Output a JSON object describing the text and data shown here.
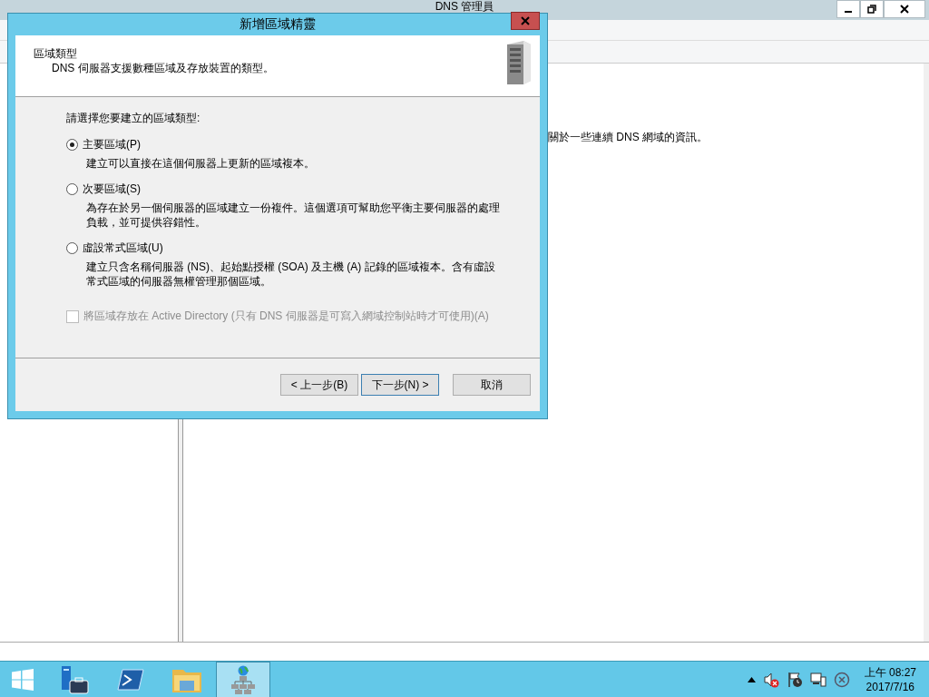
{
  "main_window": {
    "title": "DNS 管理員",
    "body_text": "關於一些連續 DNS 網域的資訊。"
  },
  "dialog": {
    "title": "新增區域精靈",
    "heading": "區域類型",
    "subheading": "DNS 伺服器支援數種區域及存放裝置的類型。",
    "prompt": "請選擇您要建立的區域類型:",
    "options": [
      {
        "label": "主要區域(P)",
        "description": "建立可以直接在這個伺服器上更新的區域複本。",
        "selected": true
      },
      {
        "label": "次要區域(S)",
        "description": "為存在於另一個伺服器的區域建立一份複件。這個選項可幫助您平衡主要伺服器的處理負載，並可提供容錯性。",
        "selected": false
      },
      {
        "label": "虛設常式區域(U)",
        "description": "建立只含名稱伺服器 (NS)、起始點授權 (SOA) 及主機 (A) 記錄的區域複本。含有虛設常式區域的伺服器無權管理那個區域。",
        "selected": false
      }
    ],
    "ad_checkbox": {
      "label": "將區域存放在 Active Directory (只有 DNS 伺服器是可寫入網域控制站時才可使用)(A)",
      "checked": false,
      "disabled": true
    },
    "buttons": [
      {
        "label": "< 上一步(B)",
        "default": false
      },
      {
        "label": "下一步(N) >",
        "default": true
      },
      {
        "label": "取消",
        "default": false
      }
    ]
  },
  "taskbar": {
    "apps": [
      {
        "kind": "server-manager",
        "selected": false
      },
      {
        "kind": "powershell",
        "selected": false
      },
      {
        "kind": "explorer",
        "selected": false
      },
      {
        "kind": "dns",
        "selected": true
      }
    ],
    "clock": {
      "time": "上午 08:27",
      "date": "2017/7/16"
    }
  }
}
